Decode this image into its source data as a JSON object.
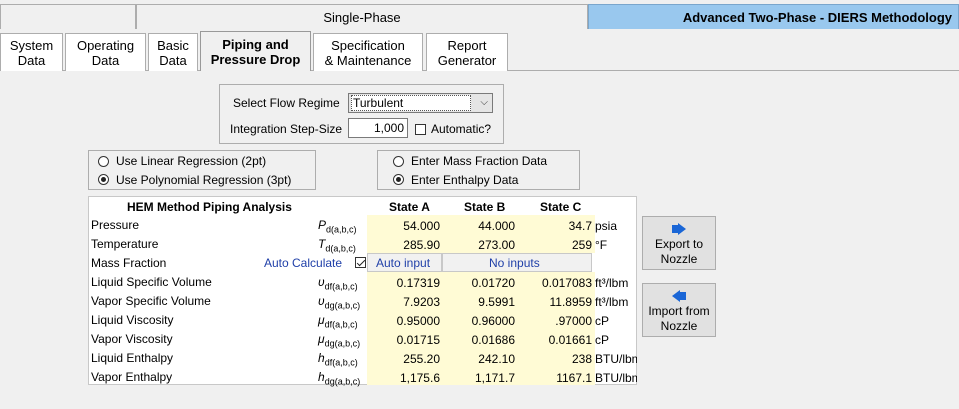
{
  "phase_tabs": [
    {
      "label": ""
    },
    {
      "label": "Single-Phase"
    },
    {
      "label": "Advanced Two-Phase - DIERS Methodology"
    }
  ],
  "sub_tabs": [
    {
      "line1": "System",
      "line2": "Data"
    },
    {
      "line1": "Operating",
      "line2": "Data"
    },
    {
      "line1": "Basic",
      "line2": "Data"
    },
    {
      "line1": "Piping and",
      "line2": "Pressure Drop"
    },
    {
      "line1": "Specification",
      "line2": "& Maintenance"
    },
    {
      "line1": "Report",
      "line2": "Generator"
    }
  ],
  "flow": {
    "regime_label": "Select Flow Regime",
    "regime_value": "Turbulent",
    "step_label": "Integration Step-Size",
    "step_value": "1,000",
    "automatic_label": "Automatic?",
    "automatic_checked": false
  },
  "regression": {
    "linear": "Use Linear Regression (2pt)",
    "poly": "Use Polynomial Regression (3pt)",
    "selected": "poly"
  },
  "entry": {
    "mass": "Enter Mass Fraction Data",
    "enthalpy": "Enter Enthalpy Data",
    "selected": "enthalpy"
  },
  "table": {
    "title": "HEM Method Piping Analysis",
    "headers": [
      "State A",
      "State B",
      "State C"
    ],
    "auto_calculate": "Auto Calculate",
    "auto_input": "Auto input",
    "no_inputs": "No inputs",
    "rows": [
      {
        "name": "Pressure",
        "sym": "P",
        "sub": "d(a,b,c)",
        "a": "54.000",
        "b": "44.000",
        "c": "34.7",
        "unit": "psia"
      },
      {
        "name": "Temperature",
        "sym": "T",
        "sub": "d(a,b,c)",
        "a": "285.90",
        "b": "273.00",
        "c": "259",
        "unit": "°F"
      },
      {
        "name": "Mass Fraction",
        "sym": "",
        "sub": "",
        "a": "",
        "b": "",
        "c": "",
        "unit": ""
      },
      {
        "name": "Liquid Specific Volume",
        "sym": "υ",
        "sub": "df(a,b,c)",
        "a": "0.17319",
        "b": "0.01720",
        "c": "0.017083",
        "unit": "ft³/lbm"
      },
      {
        "name": "Vapor Specific Volume",
        "sym": "υ",
        "sub": "dg(a,b,c)",
        "a": "7.9203",
        "b": "9.5991",
        "c": "11.8959",
        "unit": "ft³/lbm"
      },
      {
        "name": "Liquid Viscosity",
        "sym": "μ",
        "sub": "df(a,b,c)",
        "a": "0.95000",
        "b": "0.96000",
        "c": ".97000",
        "unit": "cP"
      },
      {
        "name": "Vapor Viscosity",
        "sym": "μ",
        "sub": "dg(a,b,c)",
        "a": "0.01715",
        "b": "0.01686",
        "c": "0.01661",
        "unit": "cP"
      },
      {
        "name": "Liquid Enthalpy",
        "sym": "h",
        "sub": "df(a,b,c)",
        "a": "255.20",
        "b": "242.10",
        "c": "238",
        "unit": "BTU/lbm"
      },
      {
        "name": "Vapor Enthalpy",
        "sym": "h",
        "sub": "dg(a,b,c)",
        "a": "1,175.6",
        "b": "1,171.7",
        "c": "1167.1",
        "unit": "BTU/lbm"
      }
    ]
  },
  "buttons": {
    "export_line1": "Export to",
    "export_line2": "Nozzle",
    "import_line1": "Import from",
    "import_line2": "Nozzle"
  },
  "colors": {
    "active_phase_tab": "#99c8ee",
    "input_cell": "#fffbd5",
    "auto_text": "#1f3fa8",
    "arrow_icon": "#1a66d6"
  }
}
